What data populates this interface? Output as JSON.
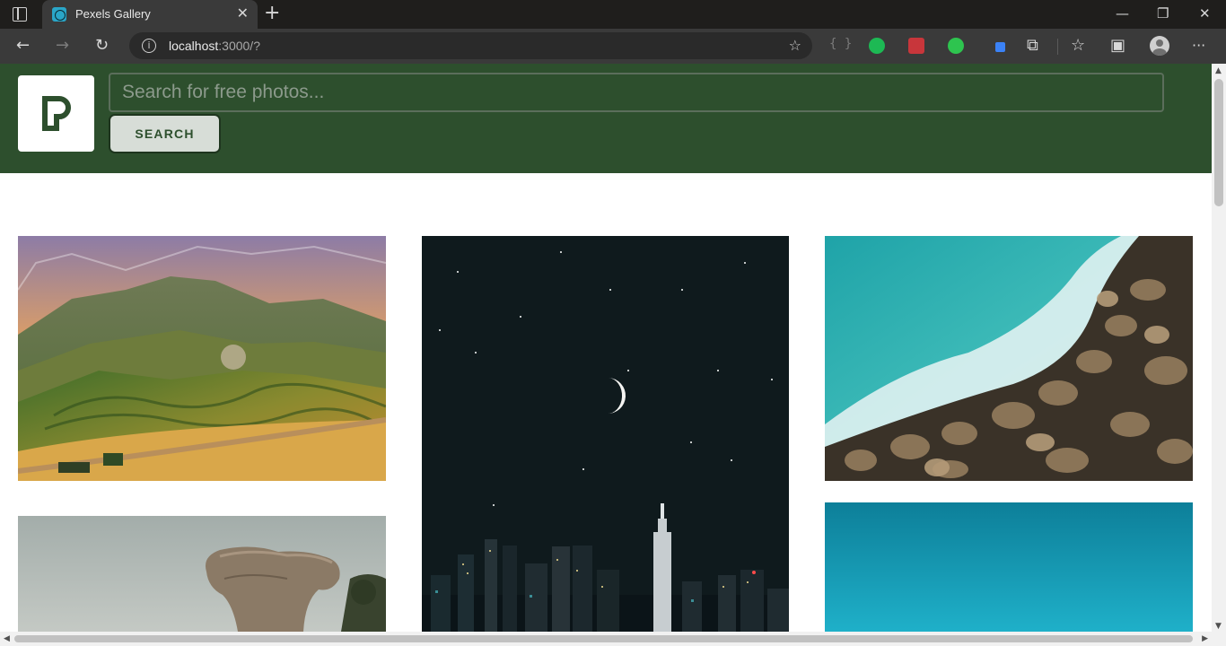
{
  "browser": {
    "tab_title": "Pexels Gallery",
    "tab_close": "✕",
    "new_tab": "+",
    "minimize": "—",
    "restore": "❐",
    "close": "✕",
    "address_host": "localhost",
    "address_path": ":3000/?",
    "icons": {
      "back": "←",
      "forward": "→",
      "refresh": "↻",
      "info": "i",
      "add_favorite": "☆",
      "extensions": "⧉",
      "favorites": "☆",
      "collections": "▣",
      "more": "···",
      "braces": "{ }"
    }
  },
  "page": {
    "search_placeholder": "Search for free photos...",
    "search_button": "SEARCH"
  },
  "colors": {
    "header_bg": "#2d4f2d",
    "button_bg": "#d7ddd7",
    "logo_fill": "#2d4f2d"
  },
  "photos": [
    {
      "name": "rolling-hills-vineyard-photo"
    },
    {
      "name": "night-sky-moon-city-skyline-photo"
    },
    {
      "name": "aerial-ocean-waves-rocks-photo"
    },
    {
      "name": "rock-formation-photo"
    },
    {
      "name": "blue-gradient-sky-photo"
    }
  ]
}
